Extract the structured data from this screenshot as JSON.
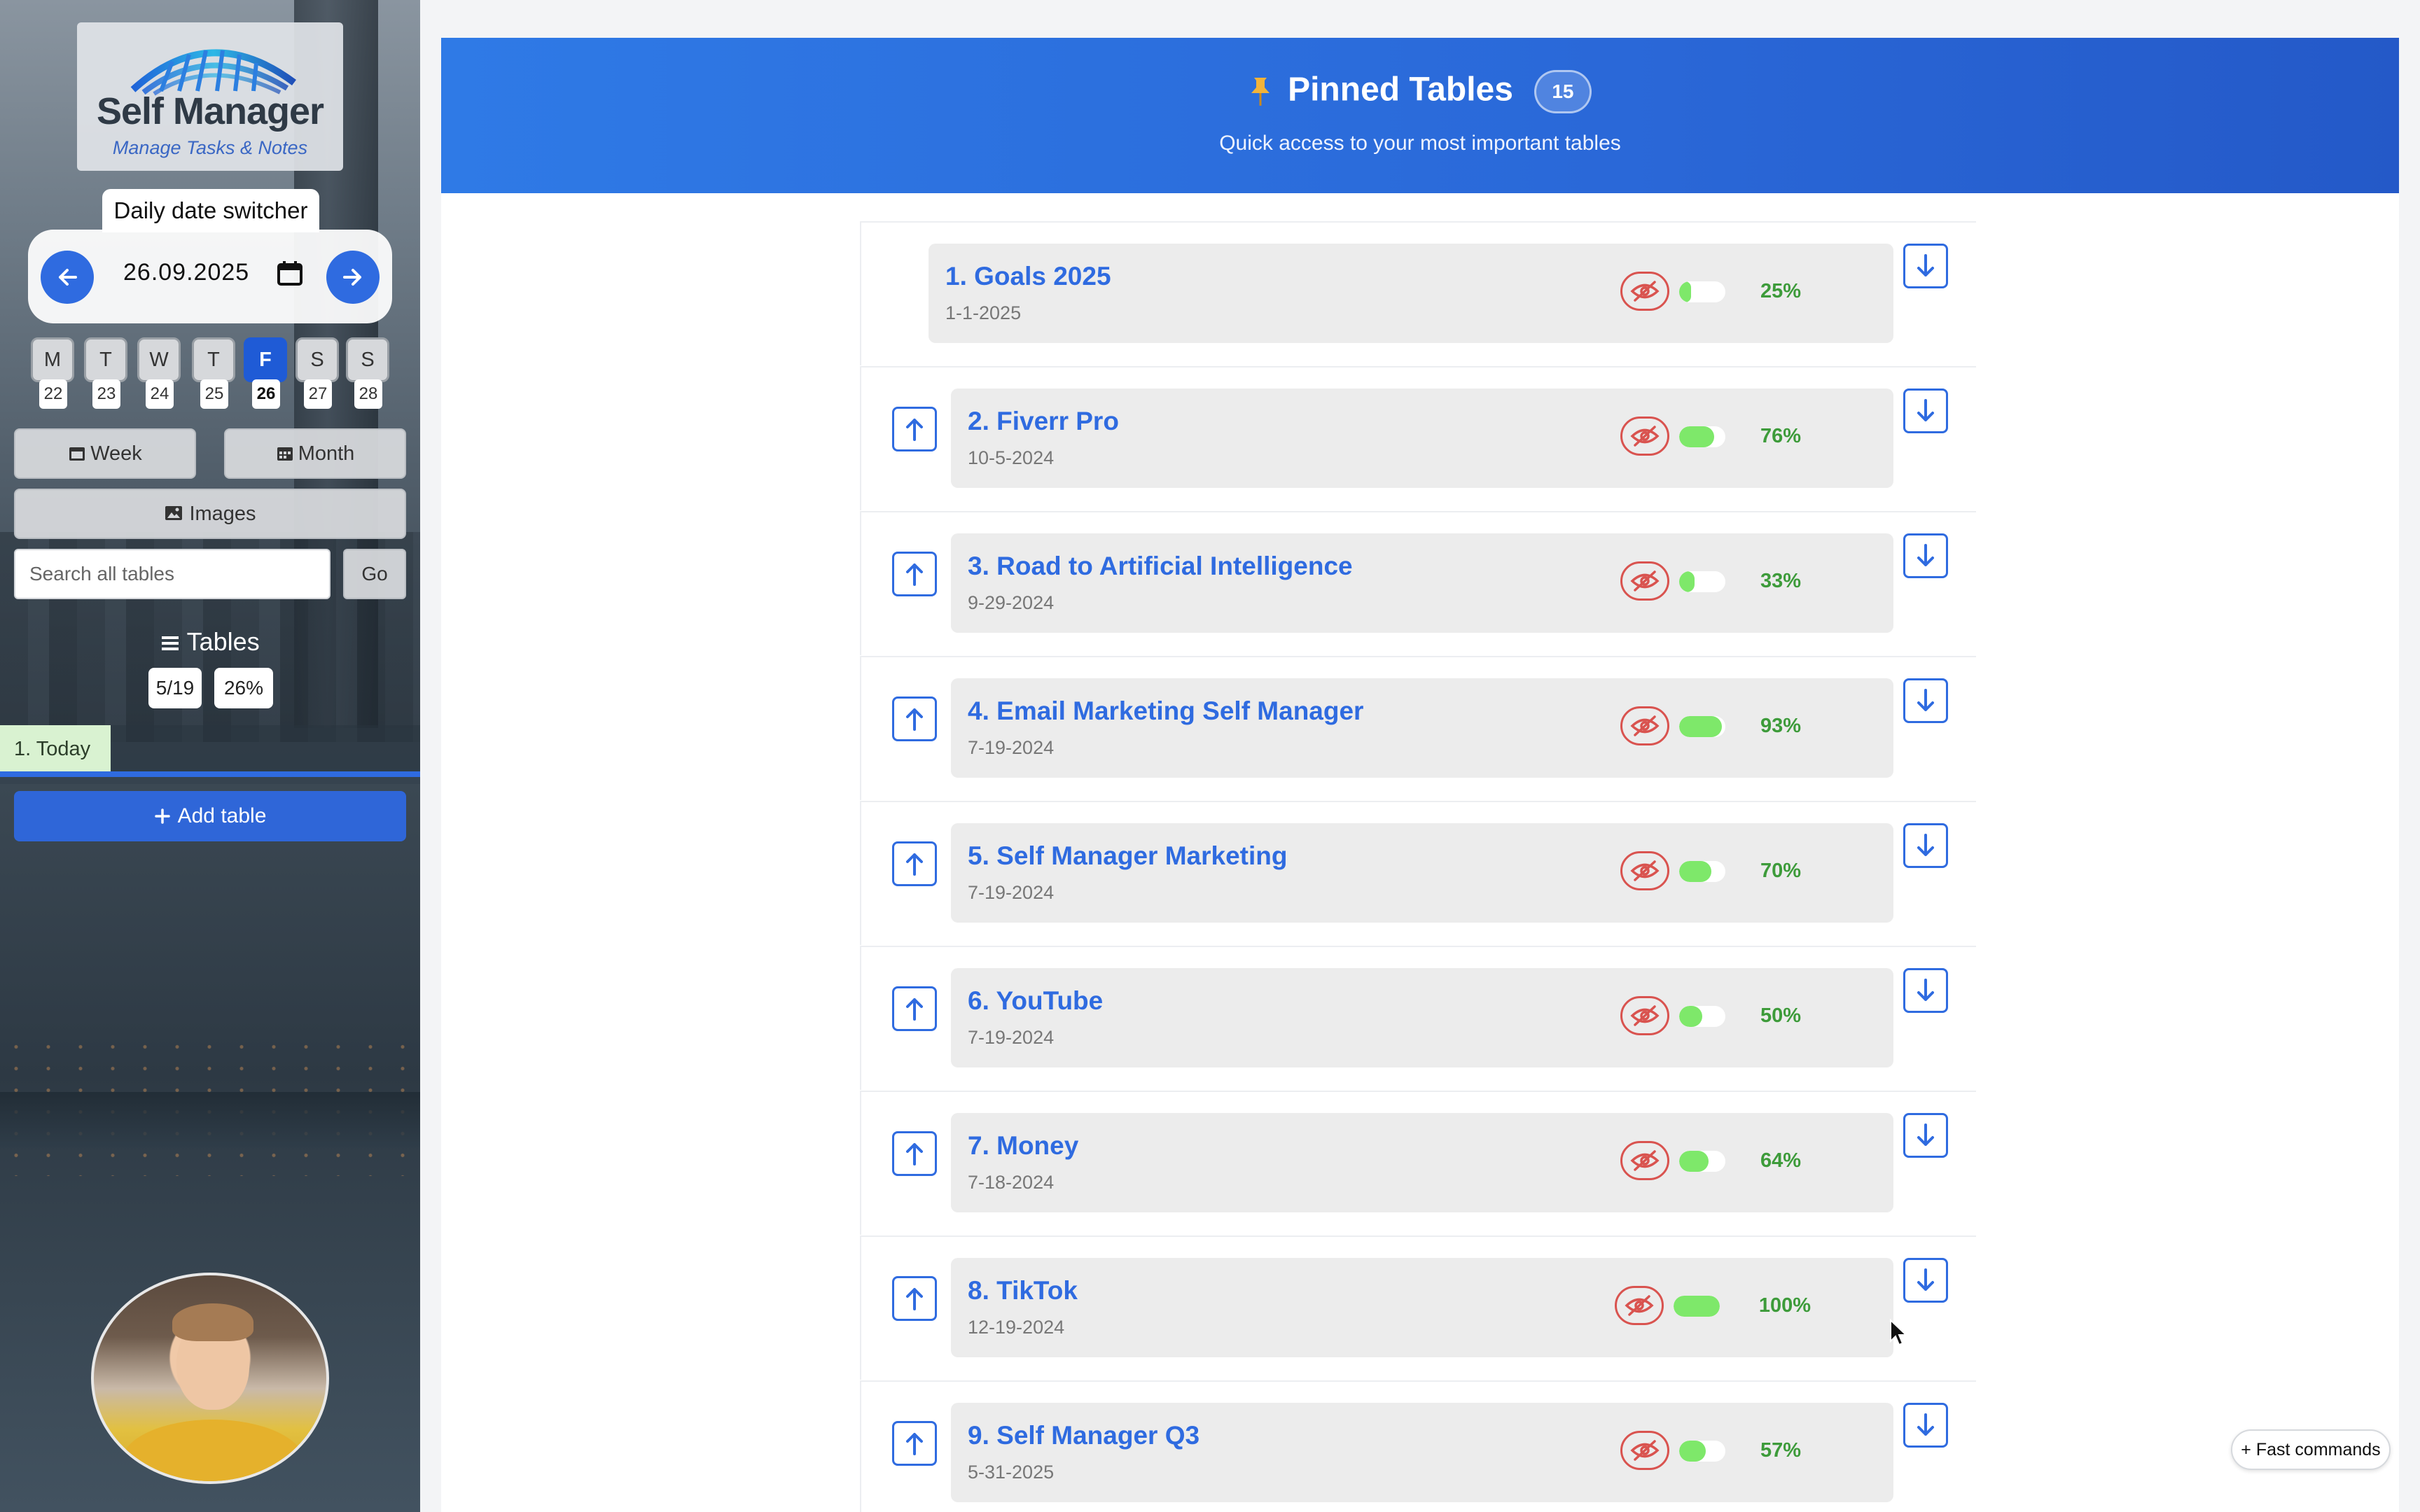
{
  "sidebar": {
    "logo": {
      "title": "Self Manager",
      "subtitle": "Manage Tasks & Notes"
    },
    "date_switcher": {
      "label": "Daily date switcher",
      "date": "26.09.2025",
      "prev_icon": "arrow-left-icon",
      "next_icon": "arrow-right-icon"
    },
    "days": [
      {
        "letter": "M",
        "num": "22"
      },
      {
        "letter": "T",
        "num": "23"
      },
      {
        "letter": "W",
        "num": "24"
      },
      {
        "letter": "T",
        "num": "25"
      },
      {
        "letter": "F",
        "num": "26",
        "active": true
      },
      {
        "letter": "S",
        "num": "27"
      },
      {
        "letter": "S",
        "num": "28"
      }
    ],
    "buttons": {
      "week": "Week",
      "month": "Month",
      "images": "Images",
      "go": "Go",
      "add_table": "Add table"
    },
    "search": {
      "placeholder": "Search all tables"
    },
    "tables": {
      "heading": "Tables",
      "count": "5/19",
      "percent": "26%"
    },
    "today_item": "1. Today"
  },
  "header": {
    "title": "Pinned Tables",
    "count": "15",
    "subtitle": "Quick access to your most important tables"
  },
  "tables": [
    {
      "title": "1. Goals 2025",
      "date": "1-1-2025",
      "percent": "25%",
      "progress": 0.25
    },
    {
      "title": "2. Fiverr Pro",
      "date": "10-5-2024",
      "percent": "76%",
      "progress": 0.76
    },
    {
      "title": "3. Road to Artificial Intelligence",
      "date": "9-29-2024",
      "percent": "33%",
      "progress": 0.33
    },
    {
      "title": "4. Email Marketing Self Manager",
      "date": "7-19-2024",
      "percent": "93%",
      "progress": 0.93
    },
    {
      "title": "5. Self Manager Marketing",
      "date": "7-19-2024",
      "percent": "70%",
      "progress": 0.7
    },
    {
      "title": "6. YouTube",
      "date": "7-19-2024",
      "percent": "50%",
      "progress": 0.5
    },
    {
      "title": "7. Money",
      "date": "7-18-2024",
      "percent": "64%",
      "progress": 0.64
    },
    {
      "title": "8. TikTok",
      "date": "12-19-2024",
      "percent": "100%",
      "progress": 1.0
    },
    {
      "title": "9. Self Manager Q3",
      "date": "5-31-2025",
      "percent": "57%",
      "progress": 0.57
    }
  ],
  "fast_commands": "+ Fast commands",
  "colors": {
    "accent": "#2f6be0",
    "progress": "#7ee86a",
    "percent_text": "#3d9b3a",
    "hide_icon": "#d9534f"
  }
}
